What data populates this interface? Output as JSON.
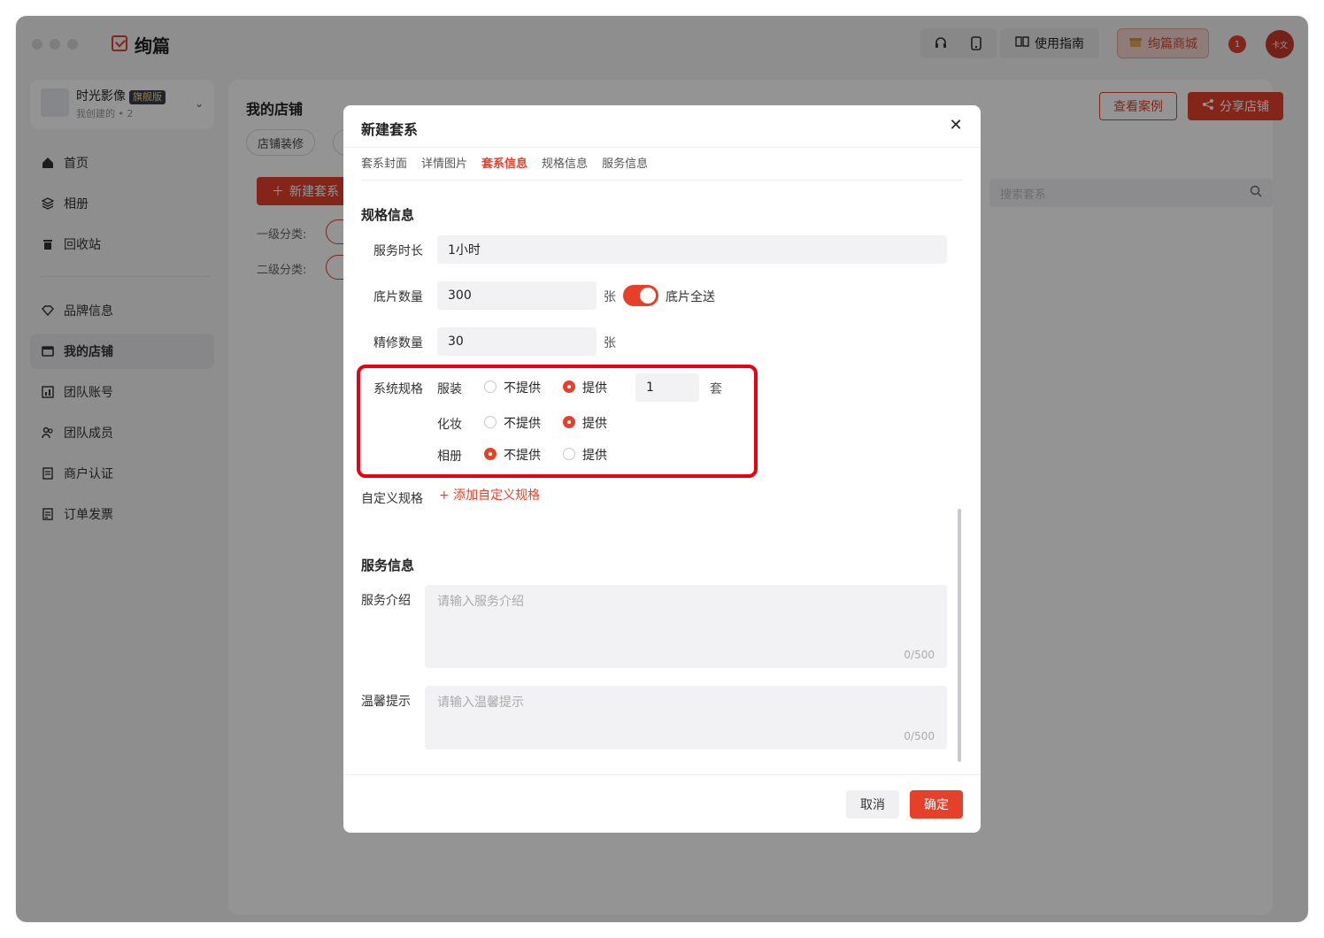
{
  "app": {
    "name": "绚篇"
  },
  "topbar": {
    "guide_label": "使用指南",
    "mall_label": "绚篇商城",
    "notif_count": "1",
    "avatar_text": "卡文"
  },
  "sidebar": {
    "store_name": "时光影像",
    "store_badge": "旗舰版",
    "store_sub": "我创建的 • 2",
    "items": [
      {
        "label": "首页",
        "icon": "home-icon"
      },
      {
        "label": "相册",
        "icon": "album-icon"
      },
      {
        "label": "回收站",
        "icon": "trash-icon"
      },
      {
        "label": "品牌信息",
        "icon": "diamond-icon"
      },
      {
        "label": "我的店铺",
        "icon": "store-icon"
      },
      {
        "label": "团队账号",
        "icon": "team-account-icon"
      },
      {
        "label": "团队成员",
        "icon": "team-members-icon"
      },
      {
        "label": "商户认证",
        "icon": "certification-icon"
      },
      {
        "label": "订单发票",
        "icon": "invoice-icon"
      }
    ]
  },
  "main": {
    "title": "我的店铺",
    "pill_decor": "店铺装修",
    "view_cases": "查看案例",
    "share_store": "分享店铺",
    "new_series": "新建套系",
    "level1_label": "一级分类:",
    "level2_label": "二级分类:",
    "search_placeholder": "搜索套系"
  },
  "modal": {
    "title": "新建套系",
    "tabs": [
      "套系封面",
      "详情图片",
      "套系信息",
      "规格信息",
      "服务信息"
    ],
    "active_tab": "套系信息",
    "spec": {
      "section_title": "规格信息",
      "duration_label": "服务时长",
      "duration_value": "1小时",
      "negatives_label": "底片数量",
      "negatives_value": "300",
      "negatives_unit": "张",
      "all_negatives_label": "底片全送",
      "all_negatives_on": true,
      "retouch_label": "精修数量",
      "retouch_value": "30",
      "retouch_unit": "张",
      "system_spec_label": "系统规格",
      "items": [
        {
          "name": "服装",
          "selected": "提供",
          "qty": "1",
          "qty_unit": "套"
        },
        {
          "name": "化妆",
          "selected": "提供"
        },
        {
          "name": "相册",
          "selected": "不提供"
        }
      ],
      "opt_no": "不提供",
      "opt_yes": "提供",
      "custom_spec_label": "自定义规格",
      "add_custom_spec": "+ 添加自定义规格"
    },
    "service": {
      "section_title": "服务信息",
      "intro_label": "服务介绍",
      "intro_placeholder": "请输入服务介绍",
      "intro_count": "0/500",
      "tips_label": "温馨提示",
      "tips_placeholder": "请输入温馨提示",
      "tips_count": "0/500"
    },
    "cancel": "取消",
    "confirm": "确定"
  },
  "colors": {
    "accent": "#e6402b",
    "highlight": "#e60012"
  }
}
